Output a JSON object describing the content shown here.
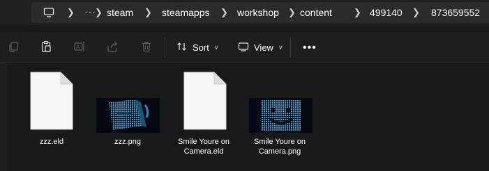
{
  "breadcrumb": {
    "more": "···",
    "items": [
      "steam",
      "steamapps",
      "workshop",
      "content",
      "499140",
      "873659552"
    ]
  },
  "toolbar": {
    "sort_label": "Sort",
    "view_label": "View",
    "more": "•••",
    "icons": [
      "copy-icon",
      "paste-icon",
      "rename-icon",
      "share-icon",
      "delete-icon"
    ]
  },
  "files": [
    {
      "name": "zzz.eld",
      "type": "document"
    },
    {
      "name": "zzz.png",
      "type": "image"
    },
    {
      "name": "Smile Youre on Camera.eld",
      "type": "document"
    },
    {
      "name": "Smile Youre on Camera.png",
      "type": "image"
    }
  ],
  "colors": {
    "background": "#191919",
    "toolbar": "#1e1e1e",
    "address_box": "#2b2b2b",
    "thumbnail_blue": "#29a8d8"
  }
}
